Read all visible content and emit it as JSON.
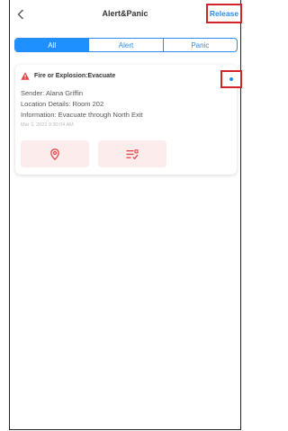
{
  "header": {
    "title": "Alert&Panic",
    "back_icon": "chevron-left-icon",
    "release_label": "Release"
  },
  "tabs": [
    {
      "label": "All",
      "active": true
    },
    {
      "label": "Alert",
      "active": false
    },
    {
      "label": "Panic",
      "active": false
    }
  ],
  "alerts": [
    {
      "type_icon": "warning-triangle-icon",
      "type": "Fire or Explosion:Evacuate",
      "sender": "Sender: Alana Griffin",
      "location": "Location Details: Room 202",
      "information": "Information: Evacuate through North Exit",
      "timestamp": "Mar 3, 2023 9:30:04 AM",
      "more_icon": "dot-menu-icon",
      "actions": [
        {
          "icon": "location-pin-icon"
        },
        {
          "icon": "checklist-icon"
        }
      ]
    }
  ],
  "colors": {
    "accent": "#2a8be8",
    "active_tab": "#1e90ff",
    "danger": "#e04646",
    "highlight_border": "#d2222a",
    "action_bg": "#fdecec"
  }
}
